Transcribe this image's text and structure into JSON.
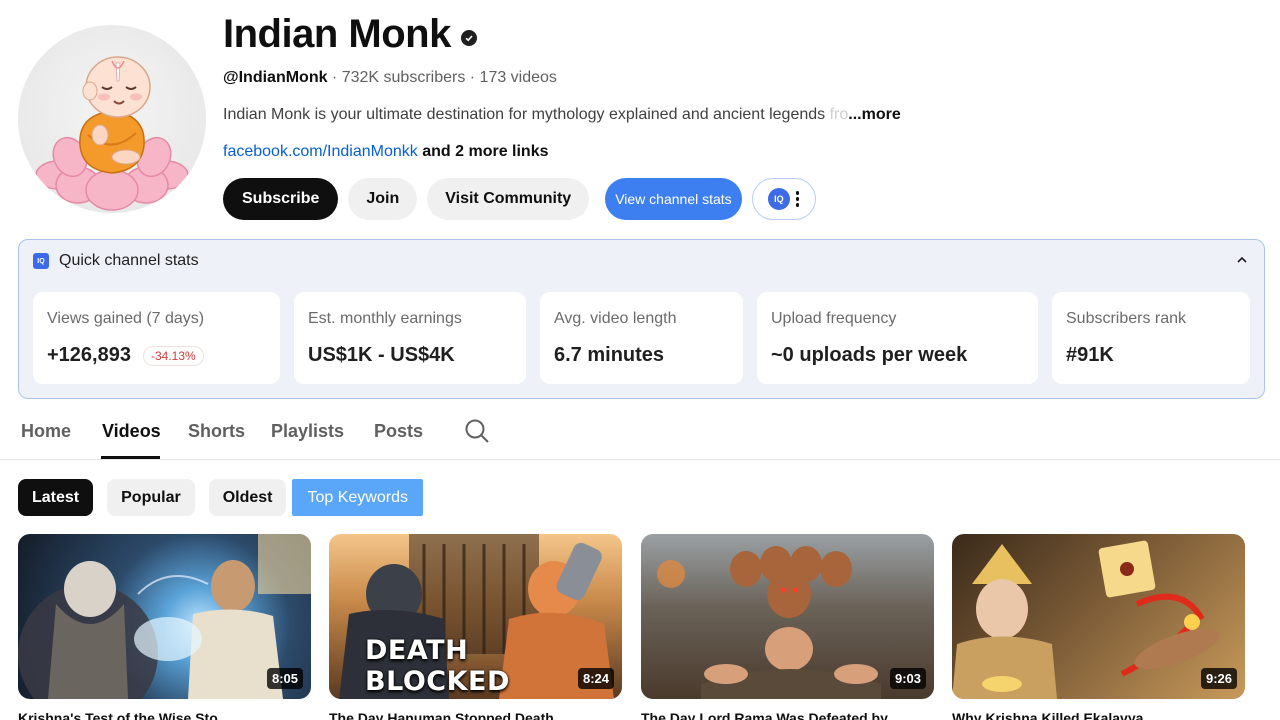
{
  "channel": {
    "name": "Indian Monk",
    "handle": "@IndianMonk",
    "meta_rest": " · 732K subscribers · 173 videos",
    "description": "Indian Monk is your ultimate destination for mythology explained and ancient legends ",
    "description_fade": "fro",
    "more_label": "...more",
    "link": "facebook.com/IndianMonkk",
    "link_suffix": " and 2 more links"
  },
  "actions": {
    "subscribe": "Subscribe",
    "join": "Join",
    "community": "Visit Community",
    "stats": "View channel stats",
    "iq_badge": "IQ"
  },
  "stats_panel": {
    "title": "Quick channel stats",
    "badge": "IQ",
    "cards": [
      {
        "label": "Views gained (7 days)",
        "value": "+126,893",
        "delta": "-34.13%"
      },
      {
        "label": "Est. monthly earnings",
        "value": "US$1K - US$4K"
      },
      {
        "label": "Avg. video length",
        "value": "6.7 minutes"
      },
      {
        "label": "Upload frequency",
        "value": "~0 uploads per week"
      },
      {
        "label": "Subscribers rank",
        "value": "#91K"
      }
    ]
  },
  "tabs": [
    "Home",
    "Videos",
    "Shorts",
    "Playlists",
    "Posts"
  ],
  "active_tab": "Videos",
  "chips": [
    "Latest",
    "Popular",
    "Oldest",
    "Top Keywords"
  ],
  "active_chip": "Latest",
  "videos": [
    {
      "duration": "8:05",
      "title": "Krishna's Test of the Wise Sto"
    },
    {
      "duration": "8:24",
      "overlay_text": "DEATH BLOCKED",
      "title": "The Day Hanuman Stopped Death"
    },
    {
      "duration": "9:03",
      "title": "The Day Lord Rama Was Defeated by"
    },
    {
      "duration": "9:26",
      "title": "Why Krishna Killed Ekalavya"
    }
  ],
  "colors": {
    "accent_blue": "#3d7ff0",
    "link_blue": "#065fd4",
    "delta_red": "#d43a3a",
    "panel_bg": "#eef2f8"
  },
  "icons": [
    "verified-icon",
    "kebab-icon",
    "chevron-up-icon",
    "search-icon"
  ]
}
